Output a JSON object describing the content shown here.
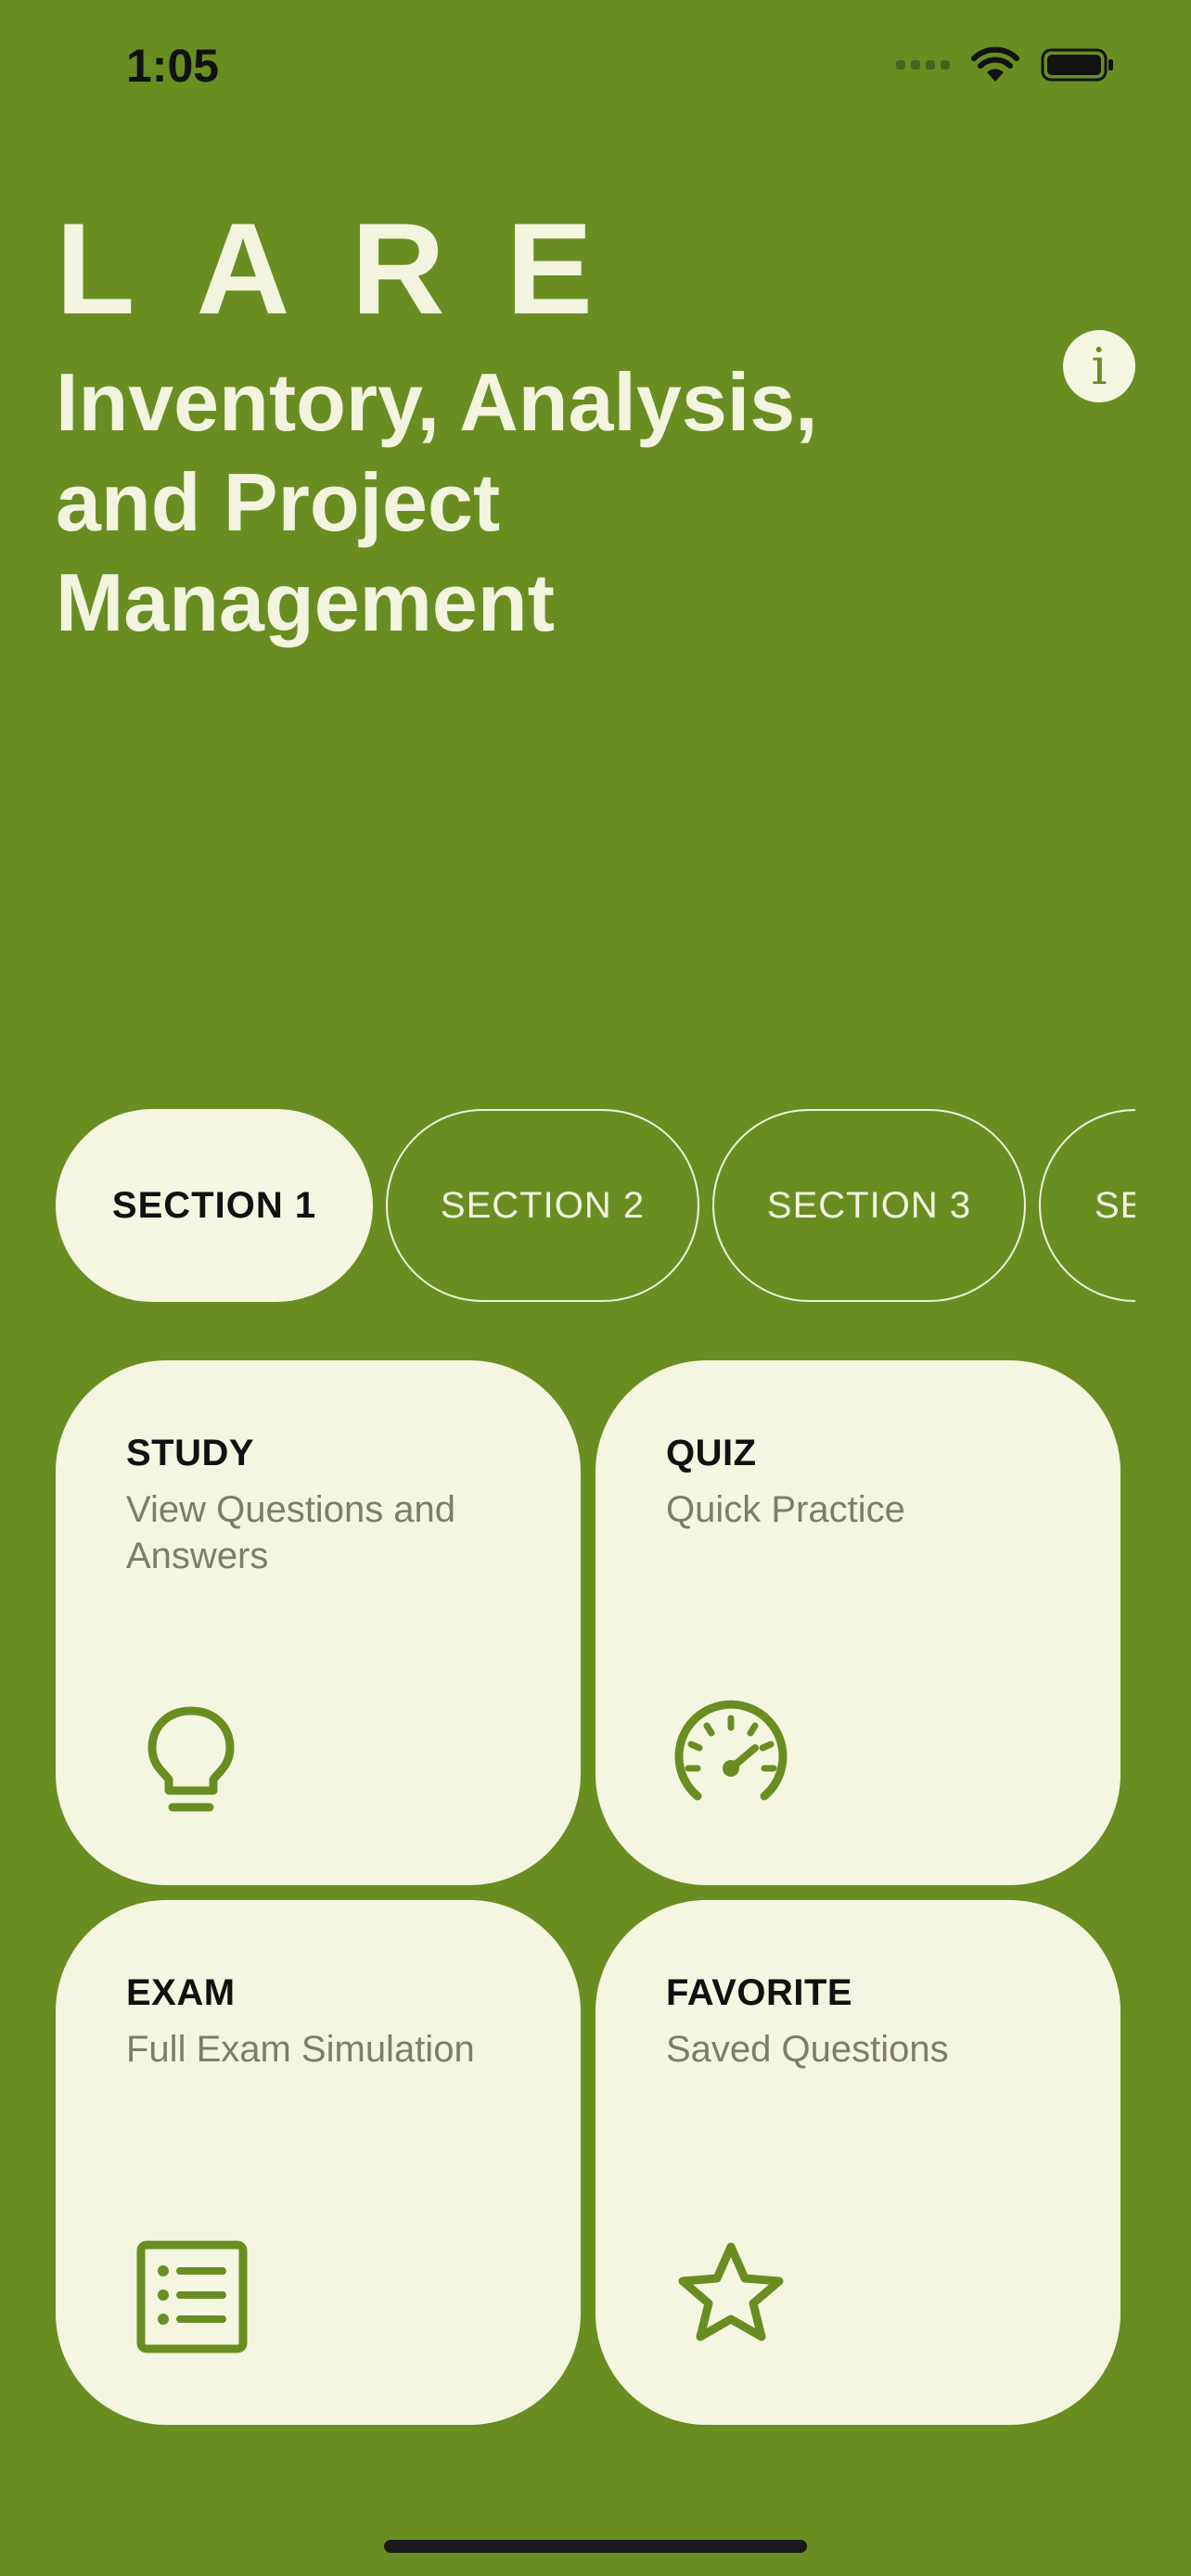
{
  "status": {
    "time": "1:05"
  },
  "header": {
    "logo": "LARE",
    "title": "Inventory, Analysis, and Project Management",
    "info_icon": "info-icon"
  },
  "sections": [
    {
      "label": "SECTION 1",
      "selected": true
    },
    {
      "label": "SECTION 2",
      "selected": false
    },
    {
      "label": "SECTION 3",
      "selected": false
    },
    {
      "label": "SE",
      "selected": false
    }
  ],
  "cards": [
    {
      "title": "STUDY",
      "subtitle": "View Questions and Answers",
      "icon": "lightbulb-icon"
    },
    {
      "title": "QUIZ",
      "subtitle": "Quick Practice",
      "icon": "speedometer-icon"
    },
    {
      "title": "EXAM",
      "subtitle": "Full Exam Simulation",
      "icon": "list-document-icon"
    },
    {
      "title": "FAVORITE",
      "subtitle": "Saved Questions",
      "icon": "star-icon"
    }
  ],
  "colors": {
    "background": "#6a8d22",
    "card": "#f5f6e1",
    "accent": "#6a8d22"
  }
}
